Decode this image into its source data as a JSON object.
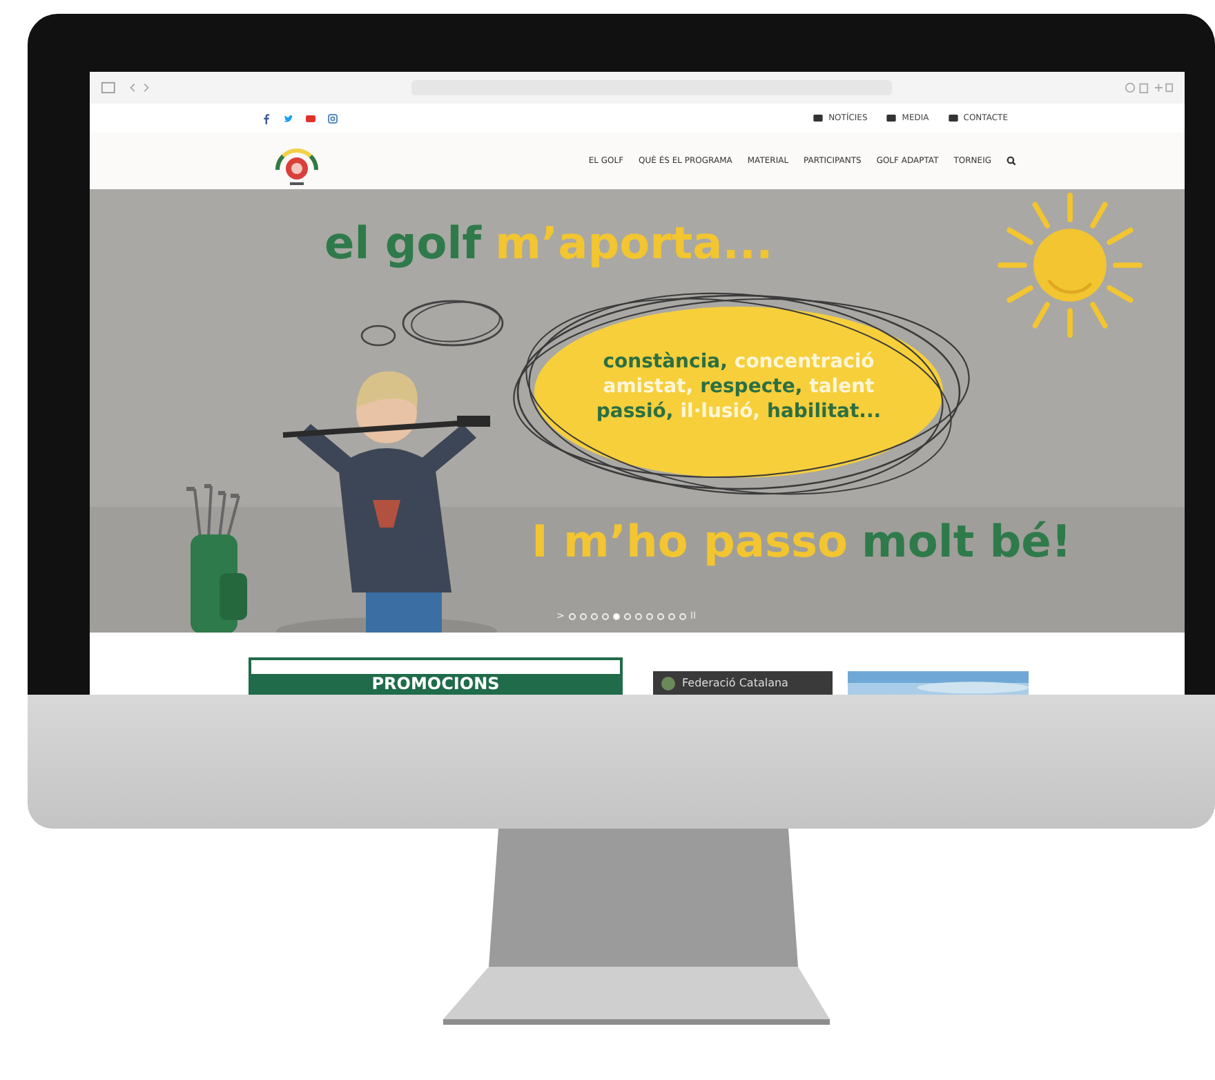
{
  "top_links": [
    {
      "label": "NOTÍCIES"
    },
    {
      "label": "MEDIA"
    },
    {
      "label": "CONTACTE"
    }
  ],
  "nav": {
    "items": [
      "EL GOLF",
      "QUÈ ÉS EL PROGRAMA",
      "MATERIAL",
      "PARTICIPANTS",
      "GOLF ADAPTAT",
      "TORNEIG"
    ]
  },
  "hero": {
    "headline": [
      {
        "text": "el golf",
        "color": "#2f7a4a"
      },
      {
        "text": "m’aporta...",
        "color": "#f2c531"
      }
    ],
    "bubble_lines": [
      [
        {
          "text": "constància,",
          "highlight": true
        },
        {
          "text": "concentració",
          "highlight": false
        }
      ],
      [
        {
          "text": "amistat,",
          "highlight": false
        },
        {
          "text": "respecte,",
          "highlight": true
        },
        {
          "text": "talent",
          "highlight": false
        }
      ],
      [
        {
          "text": "passió,",
          "highlight": true
        },
        {
          "text": "il·lusió,",
          "highlight": false
        },
        {
          "text": "habilitat...",
          "highlight": true
        }
      ]
    ],
    "tagline": [
      {
        "text": "I m’ho passo",
        "color": "#f2c531"
      },
      {
        "text": "molt bé!",
        "color": "#2f7a4a"
      }
    ],
    "pager": {
      "next": ">",
      "pause": "II",
      "slides": [
        {
          "selected": false
        },
        {
          "selected": false
        },
        {
          "selected": false
        },
        {
          "selected": false
        },
        {
          "selected": true
        },
        {
          "selected": false
        },
        {
          "selected": false
        },
        {
          "selected": false
        },
        {
          "selected": false
        },
        {
          "selected": false
        },
        {
          "selected": false
        }
      ]
    }
  },
  "promo": {
    "title": "PROMOCIONS"
  },
  "video": {
    "caption": "Federació Catalana"
  }
}
